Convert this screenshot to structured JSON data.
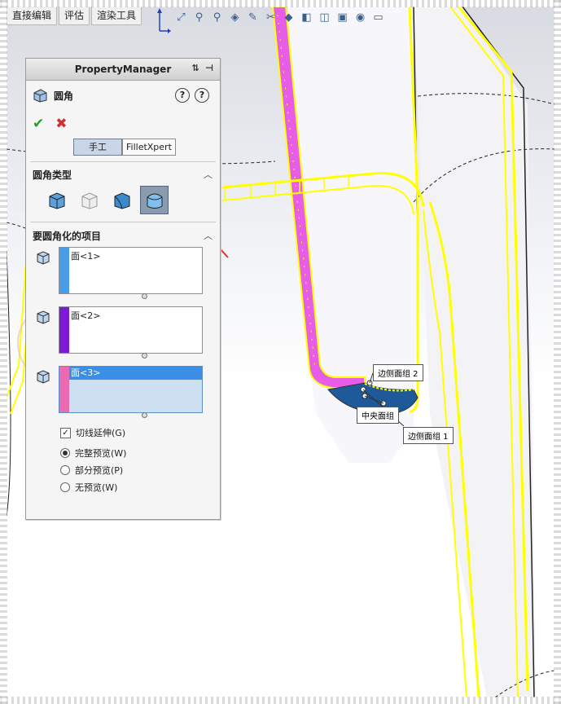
{
  "command_tabs": [
    "直接编辑",
    "评估",
    "渲染工具"
  ],
  "hud_icons": [
    "triad-icon",
    "zoom-fit-icon",
    "zoom-area-icon",
    "previous-view-icon",
    "section-view-icon",
    "view-orientation-icon",
    "display-style-icon",
    "hide-show-icon",
    "edit-appearance-icon",
    "apply-scene-icon",
    "view-settings-icon",
    "monitor-icon"
  ],
  "pm": {
    "title": "PropertyManager",
    "feature_name": "圆角",
    "help_icon": "?",
    "ok": "✔",
    "cancel": "✖",
    "mode_manual": "手工",
    "mode_filletxpert": "FilletXpert",
    "fillet_type_title": "圆角类型",
    "items_title": "要圆角化的项目",
    "selections": [
      {
        "label": "面<1>",
        "color": "#4a9be8"
      },
      {
        "label": "面<2>",
        "color": "#7d1ad8"
      },
      {
        "label": "面<3>",
        "color": "#ea6bb1"
      }
    ],
    "tangent_propagation": "切线延伸(G)",
    "preview_full": "完整预览(W)",
    "preview_partial": "部分预览(P)",
    "preview_none": "无预览(W)"
  },
  "callouts": {
    "side_face_2": "边侧面组 2",
    "center_face": "中央面组",
    "side_face_1": "边侧面组 1"
  },
  "colors": {
    "highlight_yellow": "#ffff00",
    "selection_magenta": "#e85de8",
    "panel_bg": "#f5f5f5"
  }
}
